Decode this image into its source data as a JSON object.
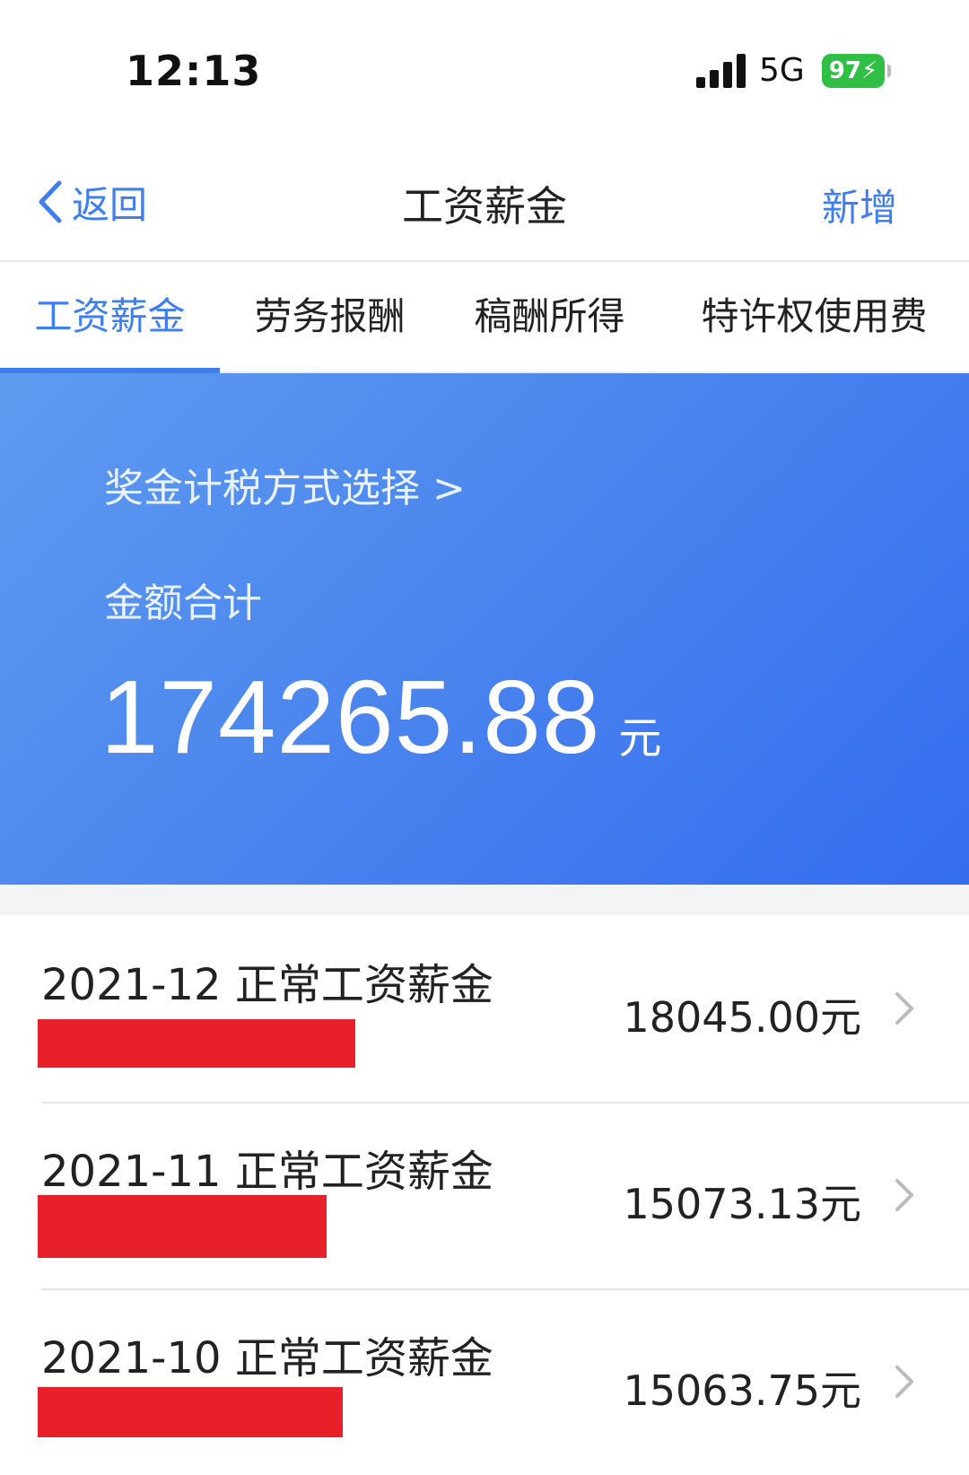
{
  "status_bar": {
    "time": "12:13",
    "network": "5G",
    "battery": "97"
  },
  "nav": {
    "back_label": "返回",
    "title": "工资薪金",
    "add_label": "新增"
  },
  "tabs": [
    {
      "label": "工资薪金",
      "active": true
    },
    {
      "label": "劳务报酬",
      "active": false
    },
    {
      "label": "稿酬所得",
      "active": false
    },
    {
      "label": "特许权使用费",
      "active": false
    }
  ],
  "summary": {
    "tax_method_link": "奖金计税方式选择 >",
    "total_label": "金额合计",
    "total_amount": "174265.88",
    "unit": "元"
  },
  "records": [
    {
      "title": "2021-12 正常工资薪金",
      "amount": "18045.00元"
    },
    {
      "title": "2021-11 正常工资薪金",
      "amount": "15073.13元"
    },
    {
      "title": "2021-10 正常工资薪金",
      "amount": "15063.75元"
    }
  ],
  "colors": {
    "accent": "#3d7ff0",
    "banner_start": "#5e9bf0",
    "banner_end": "#346cef",
    "redaction": "#e8202a",
    "battery": "#2fbf45"
  }
}
